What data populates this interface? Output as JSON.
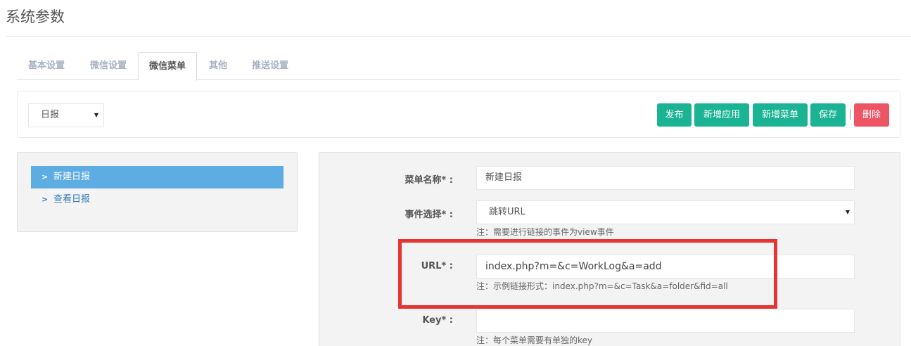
{
  "page_title": "系统参数",
  "tabs": [
    {
      "label": "基本设置",
      "active": false
    },
    {
      "label": "微信设置",
      "active": false
    },
    {
      "label": "微信菜单",
      "active": true
    },
    {
      "label": "其他",
      "active": false
    },
    {
      "label": "推送设置",
      "active": false
    }
  ],
  "toolbar": {
    "selected_menu": "日报",
    "publish_label": "发布",
    "add_app_label": "新增应用",
    "add_menu_label": "新增菜单",
    "save_label": "保存",
    "delete_label": "删除"
  },
  "sidebar": {
    "items": [
      {
        "label": "新建日报",
        "active": true
      },
      {
        "label": "查看日报",
        "active": false
      }
    ]
  },
  "form": {
    "menu_name_label": "菜单名称* :",
    "menu_name_value": "新建日报",
    "event_label": "事件选择* :",
    "event_value": "跳转URL",
    "event_help": "注：需要进行链接的事件为view事件",
    "url_label": "URL* :",
    "url_value": "index.php?m=&c=WorkLog&a=add",
    "url_help": "注：示例链接形式：index.php?m=&c=Task&a=folder&fid=all",
    "key_label": "Key* :",
    "key_value": "",
    "key_help": "注：每个菜单需要有单独的key"
  },
  "colors": {
    "primary": "#1ab394",
    "danger": "#ed5565",
    "active_item": "#5dade2",
    "highlight": "#e63333"
  }
}
